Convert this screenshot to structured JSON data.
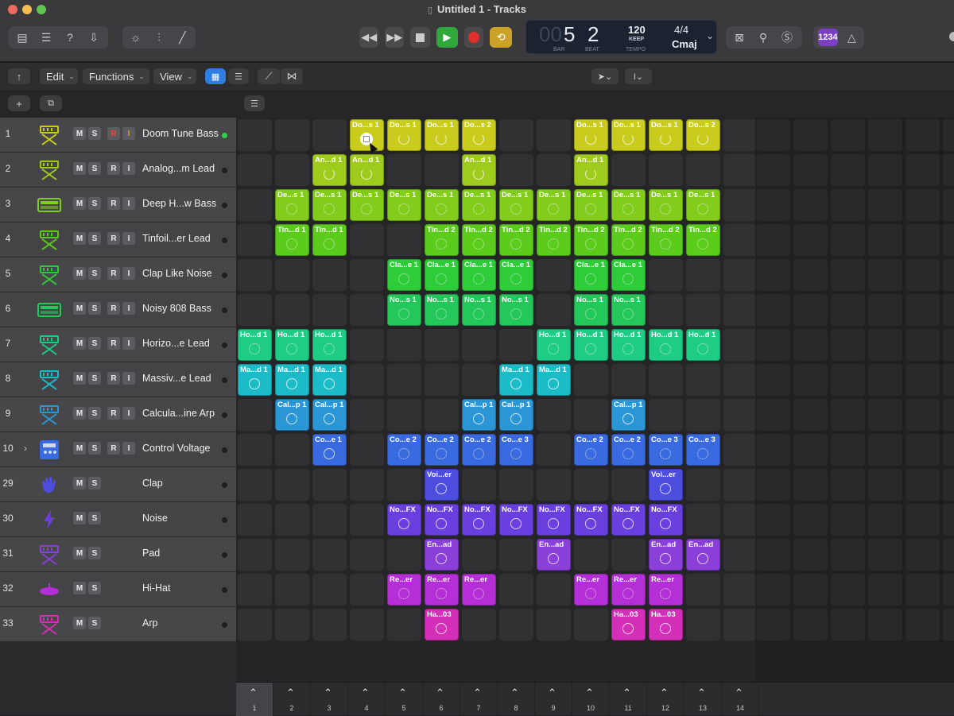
{
  "window": {
    "title": "Untitled 1 - Tracks"
  },
  "lcd": {
    "bar": "5",
    "bar_prefix": "00",
    "beat": "2",
    "bar_label": "BAR",
    "beat_label": "BEAT",
    "tempo": "120",
    "keep_label": "KEEP",
    "tempo_label": "TEMPO",
    "signature": "4/4",
    "key": "Cmaj"
  },
  "badge": {
    "label": "1234"
  },
  "menus": {
    "edit": "Edit",
    "functions": "Functions",
    "view": "View"
  },
  "colors": {
    "accent": "#2f7de1",
    "play": "#2fa93a",
    "cycle": "#c9a227",
    "record": "#e0302b",
    "badge": "#7b3fc4"
  },
  "tracks": [
    {
      "num": "1",
      "name": "Doom Tune Bass",
      "icon": "synth-keyboard-icon",
      "color": "#c9cc1c",
      "rec": true,
      "input": true,
      "active": true
    },
    {
      "num": "2",
      "name": "Analog...m Lead",
      "icon": "synth-keyboard-icon",
      "color": "#9fcc1c",
      "rec": true,
      "input": true
    },
    {
      "num": "3",
      "name": "Deep H...w Bass",
      "icon": "drum-machine-icon",
      "color": "#82cc1c",
      "rec": true,
      "input": true
    },
    {
      "num": "4",
      "name": "Tinfoil...er Lead",
      "icon": "synth-keyboard-icon",
      "color": "#5ccc1c",
      "rec": true,
      "input": true
    },
    {
      "num": "5",
      "name": "Clap Like Noise",
      "icon": "synth-keyboard-icon",
      "color": "#2fcc3a",
      "rec": true,
      "input": true
    },
    {
      "num": "6",
      "name": "Noisy 808 Bass",
      "icon": "drum-machine-icon",
      "color": "#24c75a",
      "rec": true,
      "input": true
    },
    {
      "num": "7",
      "name": "Horizo...e Lead",
      "icon": "synth-keyboard-icon",
      "color": "#1fcc85",
      "rec": true,
      "input": true
    },
    {
      "num": "8",
      "name": "Massiv...e Lead",
      "icon": "synth-keyboard-icon",
      "color": "#1bbcc7",
      "rec": true,
      "input": true
    },
    {
      "num": "9",
      "name": "Calcula...ine Arp",
      "icon": "synth-keyboard-icon",
      "color": "#2a96d6",
      "rec": true,
      "input": true
    },
    {
      "num": "10",
      "name": "Control Voltage",
      "icon": "control-voltage-icon",
      "color": "#3a6ae0",
      "rec": true,
      "input": true,
      "disclosure": true
    },
    {
      "num": "29",
      "name": "Clap",
      "icon": "hand-clap-icon",
      "color": "#4d4ee0"
    },
    {
      "num": "30",
      "name": "Noise",
      "icon": "lightning-bolt-icon",
      "color": "#6a3fe0"
    },
    {
      "num": "31",
      "name": "Pad",
      "icon": "synth-keyboard-icon",
      "color": "#8a3fd8"
    },
    {
      "num": "32",
      "name": "Hi-Hat",
      "icon": "cymbal-icon",
      "color": "#b52fd6"
    },
    {
      "num": "33",
      "name": "Arp",
      "icon": "synth-keyboard-icon",
      "color": "#d42fb8"
    }
  ],
  "clips": [
    [
      [
        4,
        "Do...s 1",
        "s"
      ],
      [
        5,
        "Do...s 1",
        "a"
      ],
      [
        6,
        "Do...s 1",
        "a"
      ],
      [
        7,
        "Do...s 2",
        "b"
      ],
      [
        10,
        "Do...s 1",
        "a"
      ],
      [
        11,
        "Do...s 1",
        "a"
      ],
      [
        12,
        "Do...s 1",
        "a"
      ],
      [
        13,
        "Do...s 2",
        "b"
      ]
    ],
    [
      [
        3,
        "An...d 1",
        "a"
      ],
      [
        4,
        "An...d 1",
        "a"
      ],
      [
        7,
        "An...d 1",
        "a"
      ],
      [
        10,
        "An...d 1",
        "a"
      ]
    ],
    [
      [
        2,
        "De...s 1",
        "d"
      ],
      [
        3,
        "De...s 1",
        "d"
      ],
      [
        4,
        "De...s 1",
        "d"
      ],
      [
        5,
        "De...s 1",
        "d"
      ],
      [
        6,
        "De...s 1",
        "d"
      ],
      [
        7,
        "De...s 1",
        "d"
      ],
      [
        8,
        "De...s 1",
        "d"
      ],
      [
        9,
        "De...s 1",
        "d"
      ],
      [
        10,
        "De...s 1",
        "d"
      ],
      [
        11,
        "De...s 1",
        "d"
      ],
      [
        12,
        "De...s 1",
        "d"
      ],
      [
        13,
        "De...s 1",
        "d"
      ]
    ],
    [
      [
        2,
        "Tin...d 1",
        "d"
      ],
      [
        3,
        "Tin...d 1",
        "d"
      ],
      [
        6,
        "Tin...d 2",
        "d"
      ],
      [
        7,
        "Tin...d 2",
        "d"
      ],
      [
        8,
        "Tin...d 2",
        "d"
      ],
      [
        9,
        "Tin...d 2",
        "d"
      ],
      [
        10,
        "Tin...d 2",
        "d"
      ],
      [
        11,
        "Tin...d 2",
        "d"
      ],
      [
        12,
        "Tin...d 2",
        "d"
      ],
      [
        13,
        "Tin...d 2",
        "d"
      ]
    ],
    [
      [
        5,
        "Cla...e 1",
        "d"
      ],
      [
        6,
        "Cla...e 1",
        "d"
      ],
      [
        7,
        "Cla...e 1",
        "d"
      ],
      [
        8,
        "Cla...e 1",
        "d"
      ],
      [
        10,
        "Cla...e 1",
        "d"
      ],
      [
        11,
        "Cla...e 1",
        "d"
      ]
    ],
    [
      [
        5,
        "No...s 1",
        "d"
      ],
      [
        6,
        "No...s 1",
        "d"
      ],
      [
        7,
        "No...s 1",
        "d"
      ],
      [
        8,
        "No...s 1",
        "d"
      ],
      [
        10,
        "No...s 1",
        "d"
      ],
      [
        11,
        "No...s 1",
        "d"
      ]
    ],
    [
      [
        1,
        "Ho...d 1",
        "d"
      ],
      [
        2,
        "Ho...d 1",
        "d"
      ],
      [
        3,
        "Ho...d 1",
        "d"
      ],
      [
        9,
        "Ho...d 1",
        "d"
      ],
      [
        10,
        "Ho...d 1",
        "d"
      ],
      [
        11,
        "Ho...d 1",
        "d"
      ],
      [
        12,
        "Ho...d 1",
        "d"
      ],
      [
        13,
        "Ho...d 1",
        "d"
      ]
    ],
    [
      [
        1,
        "Ma...d 1",
        "c"
      ],
      [
        2,
        "Ma...d 1",
        "c"
      ],
      [
        3,
        "Ma...d 1",
        "c"
      ],
      [
        8,
        "Ma...d 1",
        "c"
      ],
      [
        9,
        "Ma...d 1",
        "c"
      ]
    ],
    [
      [
        2,
        "Cal...p 1",
        "c"
      ],
      [
        3,
        "Cal...p 1",
        "c"
      ],
      [
        7,
        "Cal...p 1",
        "c"
      ],
      [
        8,
        "Cal...p 1",
        "c"
      ],
      [
        11,
        "Cal...p 1",
        "c"
      ]
    ],
    [
      [
        3,
        "Co...e 1",
        "c"
      ],
      [
        5,
        "Co...e 2",
        "d"
      ],
      [
        6,
        "Co...e 2",
        "d"
      ],
      [
        7,
        "Co...e 2",
        "d"
      ],
      [
        8,
        "Co...e 3",
        "d"
      ],
      [
        10,
        "Co...e 2",
        "d"
      ],
      [
        11,
        "Co...e 2",
        "d"
      ],
      [
        12,
        "Co...e 3",
        "d"
      ],
      [
        13,
        "Co...e 3",
        "d"
      ]
    ],
    [
      [
        6,
        "Voi...er",
        "c"
      ],
      [
        12,
        "Voi...er",
        "c"
      ]
    ],
    [
      [
        5,
        "No...FX",
        "c"
      ],
      [
        6,
        "No...FX",
        "c"
      ],
      [
        7,
        "No...FX",
        "c"
      ],
      [
        8,
        "No...FX",
        "c"
      ],
      [
        9,
        "No...FX",
        "c"
      ],
      [
        10,
        "No...FX",
        "c"
      ],
      [
        11,
        "No...FX",
        "c"
      ],
      [
        12,
        "No...FX",
        "c"
      ]
    ],
    [
      [
        6,
        "En...ad",
        "c"
      ],
      [
        9,
        "En...ad",
        "c"
      ],
      [
        12,
        "En...ad",
        "c"
      ],
      [
        13,
        "En...ad",
        "c"
      ]
    ],
    [
      [
        5,
        "Re...er",
        "d"
      ],
      [
        6,
        "Re...er",
        "d"
      ],
      [
        7,
        "Re...er",
        "d"
      ],
      [
        10,
        "Re...er",
        "d"
      ],
      [
        11,
        "Re...er",
        "d"
      ],
      [
        12,
        "Re...er",
        "d"
      ]
    ],
    [
      [
        6,
        "Ha...03",
        "c"
      ],
      [
        11,
        "Ha...03",
        "c"
      ],
      [
        12,
        "Ha...03",
        "c"
      ]
    ]
  ],
  "scenes": [
    "1",
    "2",
    "3",
    "4",
    "5",
    "6",
    "7",
    "8",
    "9",
    "10",
    "11",
    "12",
    "13",
    "14"
  ],
  "ms_labels": {
    "m": "M",
    "s": "S",
    "r": "R",
    "i": "I"
  }
}
